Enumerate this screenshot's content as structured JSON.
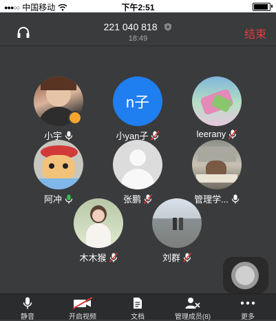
{
  "status_bar": {
    "carrier": "中国移动",
    "time": "下午2:51"
  },
  "header": {
    "meeting_id": "221 040 818",
    "duration": "18:49",
    "end_label": "结束"
  },
  "members": [
    {
      "name": "小宇",
      "mic": "on"
    },
    {
      "name": "小yan子",
      "mic": "muted",
      "avatar_text": "n子",
      "avatar_color": "#1f7ef0"
    },
    {
      "name": "leerany",
      "mic": "muted"
    },
    {
      "name": "阿冲",
      "mic": "speaking"
    },
    {
      "name": "张鹏",
      "mic": "muted"
    },
    {
      "name": "管理学...",
      "mic": "on"
    },
    {
      "name": "木木猴",
      "mic": "muted"
    },
    {
      "name": "刘群",
      "mic": "muted"
    }
  ],
  "tabbar": {
    "mute": "静音",
    "video": "开启视频",
    "docs": "文档",
    "manage": "管理成员(8)",
    "more": "更多"
  },
  "icons": {
    "headset": "headset-icon",
    "shield": "shield-icon",
    "mic": "microphone-icon",
    "muted": "microphone-muted-icon",
    "video_off": "video-off-icon",
    "docs": "document-icon",
    "members": "members-icon",
    "more": "more-dots-icon"
  },
  "colors": {
    "background": "#3a3b3d",
    "end_red": "#e43b3b",
    "mute_red": "#e23b3b",
    "speaking_green": "#33c24d",
    "avatar_blue": "#1f7ef0"
  }
}
